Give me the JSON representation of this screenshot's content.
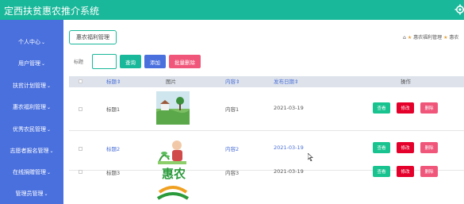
{
  "app": {
    "title": "定西扶贫惠农推介系统"
  },
  "sidebar": {
    "items": [
      {
        "label": "个人中心"
      },
      {
        "label": "用户管理"
      },
      {
        "label": "扶贫计划管理"
      },
      {
        "label": "惠农福利管理"
      },
      {
        "label": "优秀农民管理"
      },
      {
        "label": "志愿者报名管理"
      },
      {
        "label": "在线捐赠管理"
      },
      {
        "label": "管理员管理"
      }
    ]
  },
  "tab": {
    "label": "惠农福利管理"
  },
  "breadcrumb": {
    "item1": "惠农福利管理",
    "item2": "惠农"
  },
  "search": {
    "label": "标题",
    "value": ""
  },
  "toolbar": {
    "query": "查询",
    "add": "添加",
    "batch_delete": "批量删除"
  },
  "colors": {
    "topbar": "#19b89a",
    "sidebar": "#4a70de",
    "view": "#19c38f",
    "edit": "#e4002b",
    "delete": "#f0567a",
    "query": "#19b89a",
    "add": "#4a70de",
    "batch": "#f0567a"
  },
  "table": {
    "headers": {
      "title": "标题",
      "image": "图片",
      "content": "内容",
      "date": "发布日期",
      "actions": "操作"
    },
    "rows": [
      {
        "title": "标题1",
        "content": "内容1",
        "date": "2021-03-19",
        "image_icon": "village-image"
      },
      {
        "title": "标题2",
        "content": "内容2",
        "date": "2021-03-19",
        "image_icon": "farmer-image"
      },
      {
        "title": "标题3",
        "content": "内容3",
        "date": "2021-03-19",
        "image_icon": "huinong-logo-image"
      }
    ],
    "actions": {
      "view": "查看",
      "edit": "修改",
      "delete": "删除"
    }
  },
  "logo": {
    "text": "惠农"
  }
}
